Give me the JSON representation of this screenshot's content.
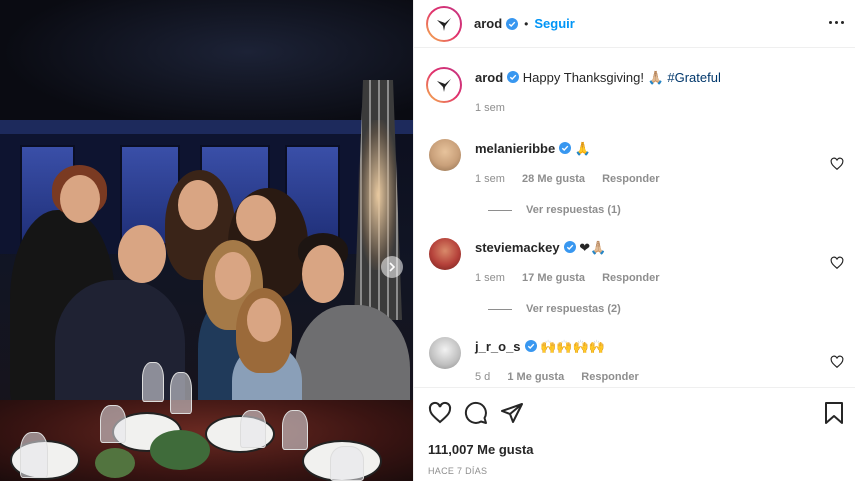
{
  "post": {
    "username": "arod",
    "follow_label": "Seguir",
    "separator": "•",
    "caption_text": "Happy Thanksgiving! 🙏🏼",
    "caption_hashtag": "#Grateful",
    "caption_time": "1 sem"
  },
  "comments": [
    {
      "username": "melanieribbe",
      "text": "🙏",
      "time": "1 sem",
      "likes": "28 Me gusta",
      "reply_label": "Responder",
      "view_replies": "Ver respuestas (1)",
      "avatar_color": "#c9a07a"
    },
    {
      "username": "steviemackey",
      "text": "❤🙏🏼",
      "time": "1 sem",
      "likes": "17 Me gusta",
      "reply_label": "Responder",
      "view_replies": "Ver respuestas (2)",
      "avatar_color": "#b5413a"
    },
    {
      "username": "j_r_o_s",
      "text": "🙌🙌🙌🙌",
      "time": "5 d",
      "likes": "1 Me gusta",
      "reply_label": "Responder",
      "avatar_color": "#bfbfbf"
    }
  ],
  "footer": {
    "likes": "111,007 Me gusta",
    "posted_ago": "HACE 7 DÍAS"
  },
  "icons": {
    "like": "heart-icon",
    "comment": "comment-icon",
    "share": "share-icon",
    "save": "bookmark-icon",
    "more": "more-options-icon",
    "verified": "verified-badge-icon",
    "next": "chevron-right-icon"
  },
  "colors": {
    "link_blue": "#0095f6",
    "hashtag": "#00376b",
    "muted": "#8e8e8e",
    "verified": "#3897f0"
  }
}
